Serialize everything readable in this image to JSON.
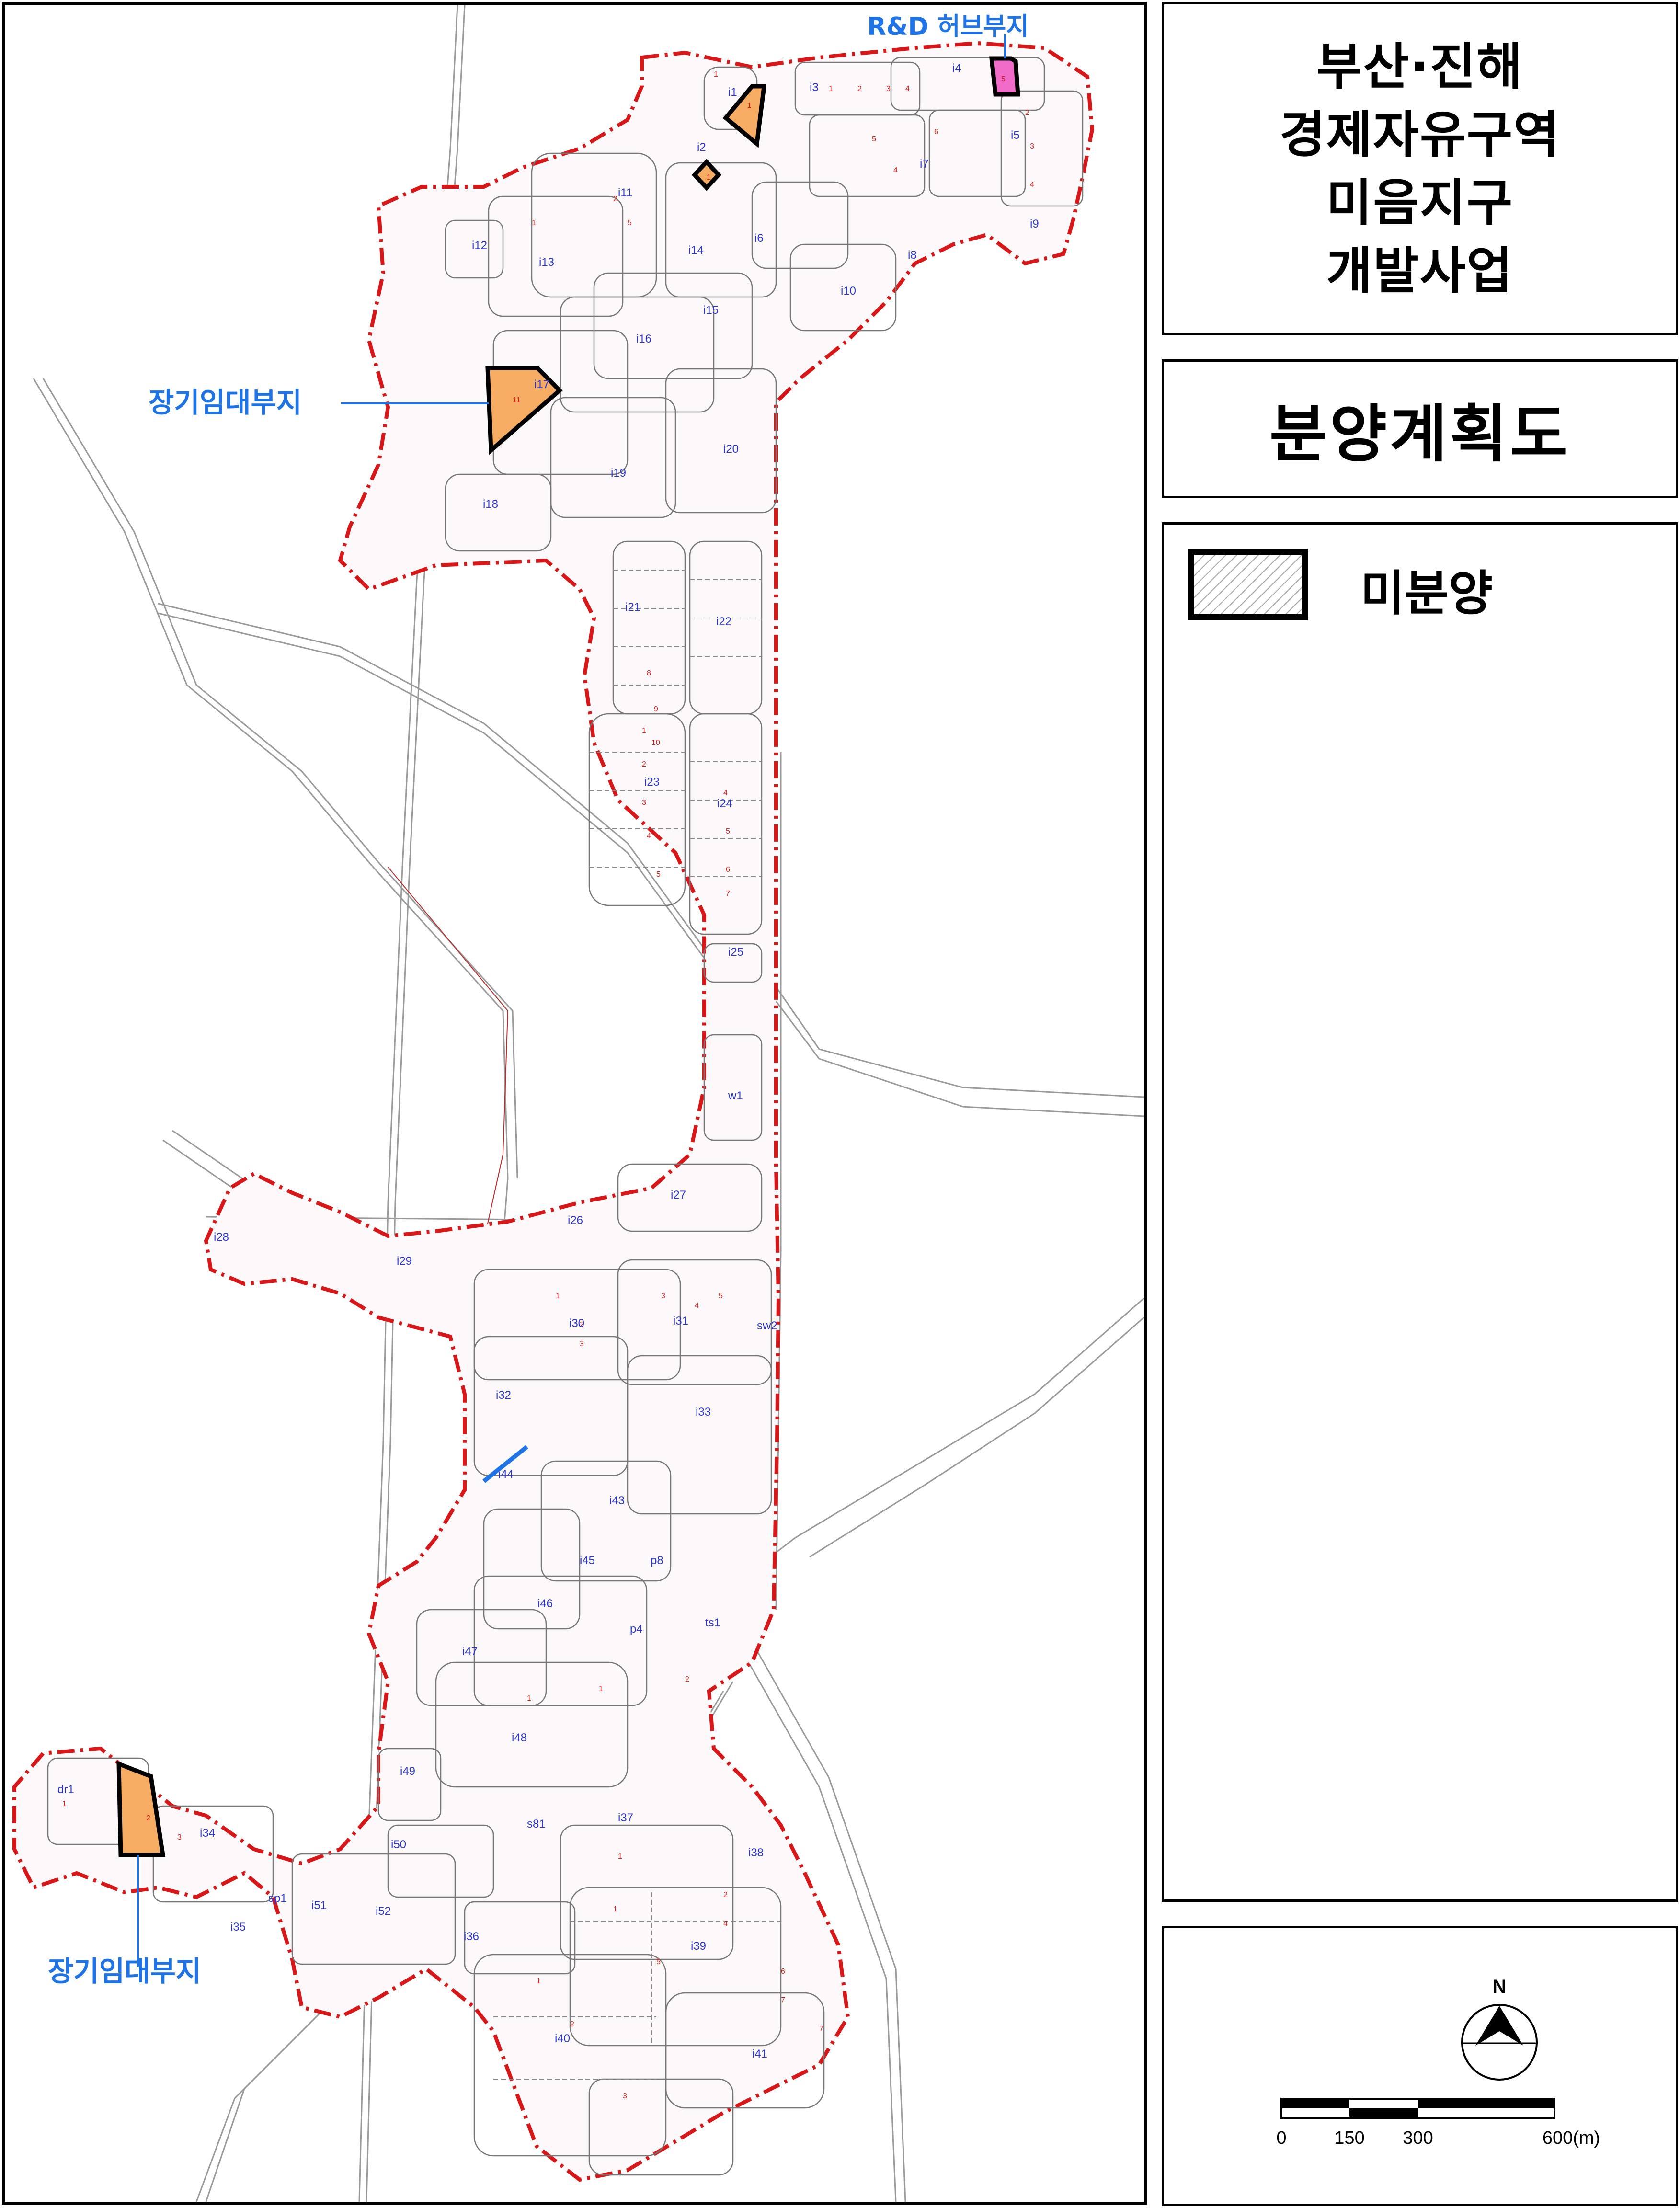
{
  "title_lines": [
    "부산·진해",
    "경제자유구역",
    "미음지구",
    "개발사업"
  ],
  "heading": "분양계획도",
  "legend": {
    "swatch_pattern": "diagonal-hatch",
    "label": "미분양"
  },
  "map_labels": {
    "rnd_hub": "R&D 허브부지",
    "long_term_lease_north": "장기임대부지",
    "long_term_lease_south": "장기임대부지"
  },
  "zone_codes": [
    "i1",
    "i2",
    "i3",
    "i4",
    "i5",
    "i6",
    "i7",
    "i8",
    "i9",
    "i10",
    "i11",
    "i12",
    "i13",
    "i14",
    "i15",
    "i16",
    "i17",
    "i18",
    "i19",
    "i20",
    "i21",
    "i22",
    "i23",
    "i24",
    "i25",
    "w1",
    "i26",
    "i27",
    "i28",
    "i29",
    "i30",
    "i31",
    "i32",
    "i33",
    "i44",
    "i43",
    "i45",
    "i46",
    "i47",
    "i48",
    "i49",
    "i50",
    "i51",
    "i52",
    "i34",
    "i35",
    "i36",
    "i37",
    "i38",
    "i39",
    "i40",
    "i41",
    "dr1",
    "sp1",
    "sw2",
    "p4",
    "p8",
    "ts1",
    "s81"
  ],
  "north_arrow": {
    "label": "N"
  },
  "scale_bar": {
    "ticks": [
      "0",
      "150",
      "300",
      "600(m)"
    ]
  },
  "colors": {
    "boundary": "#d81818",
    "unsold_fill": "#f6ac63",
    "rnd_hub_fill": "#f06cc8",
    "label_blue": "#1e73e6",
    "zone_text": "#2a35c8",
    "lot_text": "#d81818"
  }
}
